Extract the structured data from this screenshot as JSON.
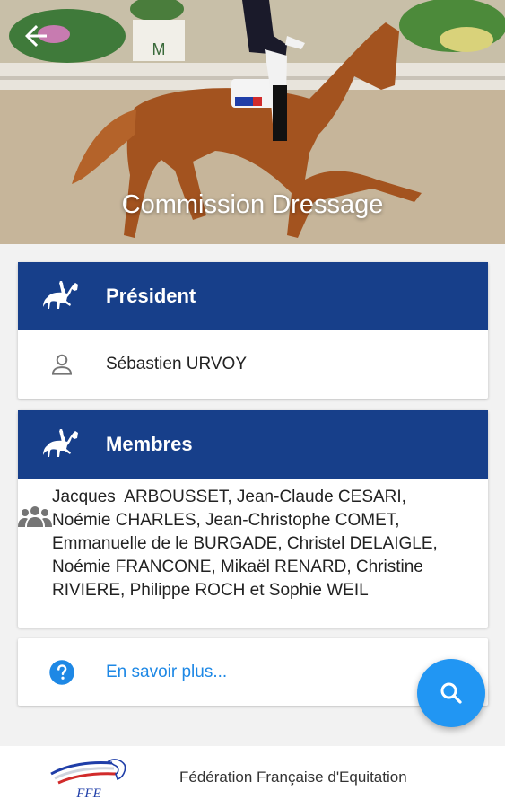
{
  "hero": {
    "title": "Commission Dressage",
    "arena_letter": "M"
  },
  "president": {
    "header": "Président",
    "name": "Sébastien URVOY"
  },
  "members": {
    "header": "Membres",
    "text": "Jacques  ARBOUSSET, Jean-Claude CESARI, Noémie CHARLES, Jean-Christophe COMET,  Emmanuelle de le BURGADE, Christel DELAIGLE, Noémie FRANCONE, Mikaël RENARD, Christine RIVIERE, Philippe ROCH et Sophie WEIL"
  },
  "more": {
    "label": "En savoir plus..."
  },
  "footer": {
    "logo_text": "FFE",
    "federation": "Fédération Française d'Equitation"
  },
  "colors": {
    "header_blue": "#173f8a",
    "accent_blue": "#2196f3",
    "link_blue": "#1e88e5"
  },
  "icons": {
    "back": "arrow-left-icon",
    "section": "dressage-horse-icon",
    "person": "person-icon",
    "group": "group-icon",
    "help": "help-circle-icon",
    "search": "search-icon"
  }
}
